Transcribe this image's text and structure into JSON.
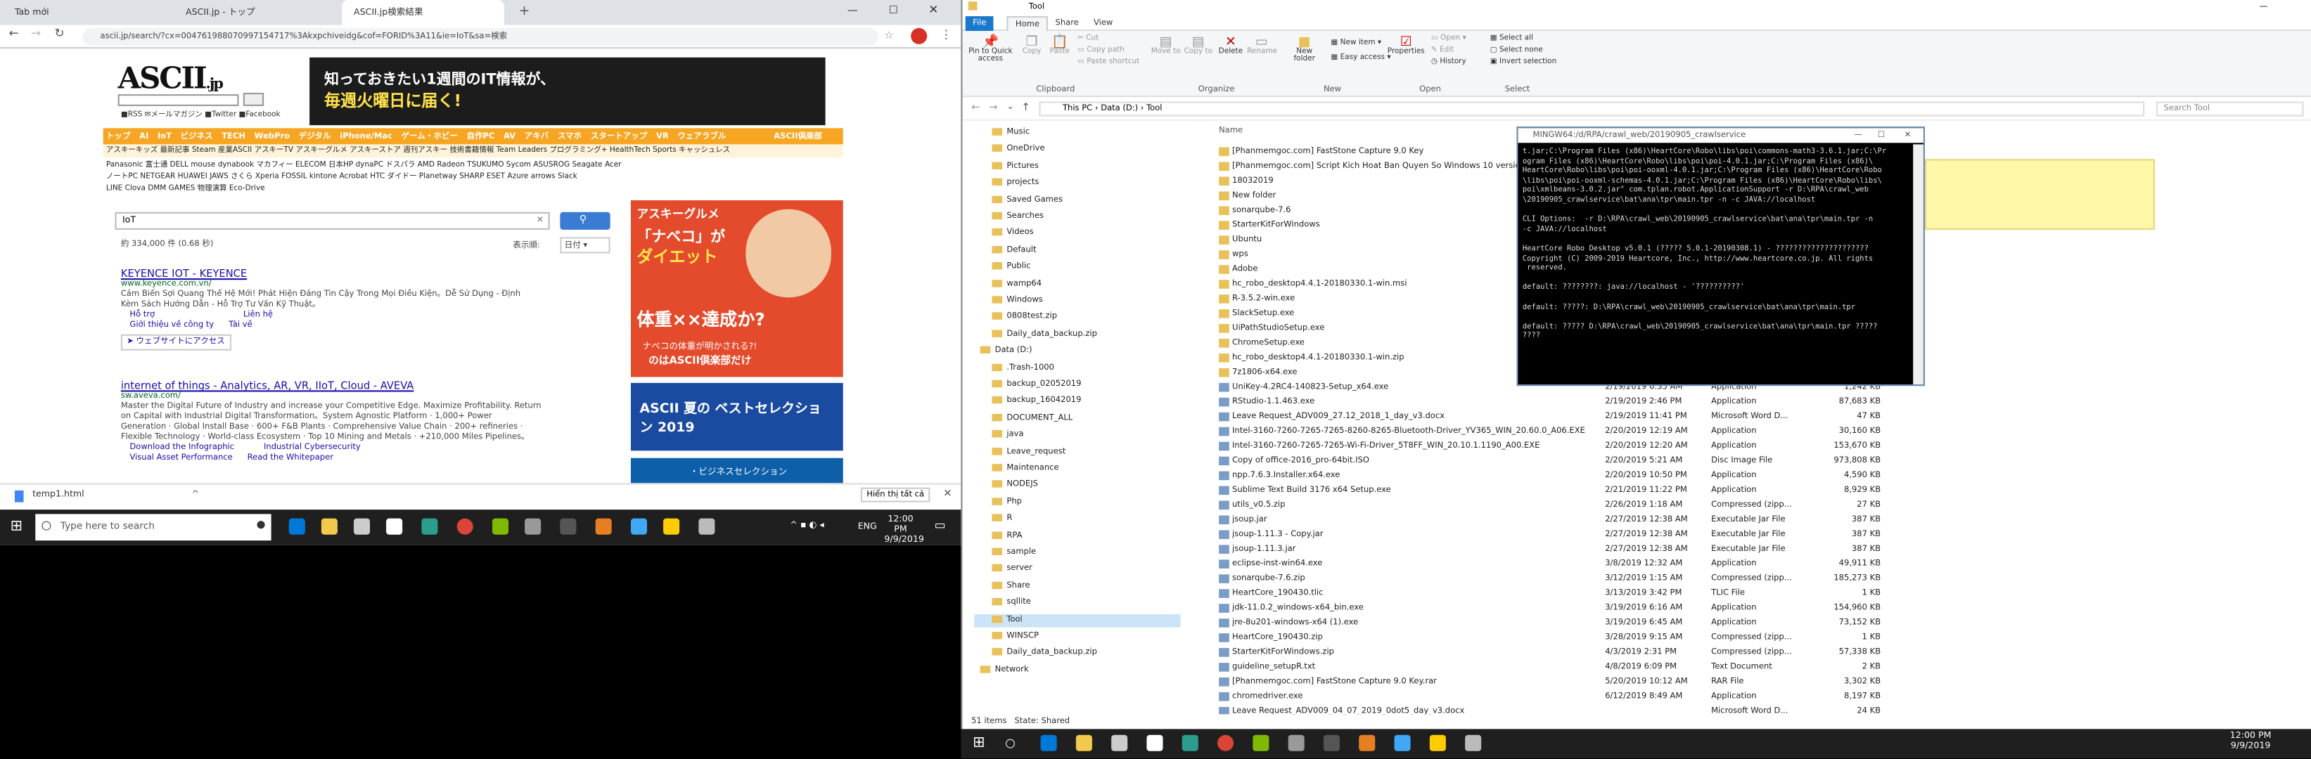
{
  "browser": {
    "tabs": [
      "Tab mới",
      "ASCII.jp - トップ",
      "ASCII.jp検索結果"
    ],
    "url": "ascii.jp/search/?cx=004761988070997154717%3Akxpchiveidg&cof=FORID%3A11&ie=IoT&sa=検索",
    "page": {
      "logo": "ASCII",
      "logo_suffix": ".jp",
      "banner_line1": "知っておきたい1週間のIT情報が、",
      "banner_line2": "毎週火曜日に届く!",
      "nav_items": [
        "トップ",
        "AI",
        "IoT",
        "ビジネス",
        "TECH",
        "WebPro",
        "デジタル",
        "iPhone/Mac",
        "ゲーム・ホビー",
        "自作PC",
        "AV",
        "アキバ",
        "スマホ",
        "スタートアップ",
        "VR",
        "ウェアラブル"
      ],
      "nav_right": "ASCII倶楽部",
      "nav2": "アスキーキッズ 最新記事 Steam 産業ASCII アスキーTV アスキーグルメ アスキーストア 週刊アスキー 技術書籍情報 Team Leaders プログラミング+ HealthTech Sports キャッシュレス",
      "nav3a": "Panasonic 富士通 DELL mouse dynabook マカフィー ELECOM 日本HP dynaPC ドスパラ AMD Radeon TSUKUMO Sycom ASUSROG Seagate Acer",
      "nav3b": "ノートPC NETGEAR HUAWEI JAWS さくら Xperia FOSSIL kintone Acrobat HTC ダイドー Planetway SHARP ESET Azure arrows Slack",
      "nav3c": "LINE Clova DMM GAMES 物理演算 Eco-Drive",
      "query": "IoT",
      "search_button": "",
      "result_count": "約 334,000 件 (0.68 秒)",
      "sort_label": "表示順:",
      "sort_value": "日付",
      "results": [
        {
          "title": "KEYENCE IOT - KEYENCE",
          "url": "www.keyence.com.vn/",
          "snippet1": "Cảm Biến Sợi Quang Thế Hệ Mới! Phát Hiện Đáng Tin Cậy Trong Mọi Điều Kiện。Dễ Sử Dụng - Định",
          "snippet2": "Kèm Sách Hướng Dẫn - Hỗ Trợ Tư Vấn Kỹ Thuật。",
          "links": [
            "Hỗ trợ",
            "Liên hệ",
            "Giới thiệu về công ty",
            "Tài về"
          ],
          "cta": "ウェブサイトにアクセス"
        },
        {
          "title": "internet of things - Analytics, AR, VR, IIoT, Cloud - AVEVA",
          "url": "sw.aveva.com/",
          "snippet1": "Master the Digital Future of Industry and increase your Competitive Edge. Maximize Profitability. Return",
          "snippet2": "on Capital with Industrial Digital Transformation。System Agnostic Platform · 1,000+ Power",
          "snippet3": "Generation · Global Install Base · 600+ F&B Plants · Comprehensive Value Chain · 200+ refineries ·",
          "snippet4": "Flexible Technology · World-class Ecosystem · Top 10 Mining and Metals · +210,000 Miles Pipelines。",
          "links": [
            "Download the Infographic",
            "Industrial Cybersecurity",
            "Visual Asset Performance",
            "Read the Whitepaper"
          ]
        }
      ],
      "ad_text1": "アスキーグルメ",
      "ad_text2": "「ナベコ」が",
      "ad_text3": "ダイエット",
      "ad_text4": "体重××達成か?",
      "ad_text5": "ナベコの体重が明かされる?!",
      "ad_text6": "のはASCII倶楽部だけ",
      "ad2_text": "ASCII 夏の ベストセレクション 2019",
      "ad3_text": "・ビジネスセレクション"
    },
    "download": {
      "file": "temp1.html",
      "show_all": "Hiển thị tất cả"
    }
  },
  "taskbar_left": {
    "search": "Type here to search",
    "time": "12:00 PM",
    "date": "9/9/2019",
    "lang": "ENG"
  },
  "explorer": {
    "title": "Tool",
    "tabs": [
      "File",
      "Home",
      "Share",
      "View"
    ],
    "ribbon": {
      "pin": "Pin to Quick access",
      "copy": "Copy",
      "paste": "Paste",
      "cut": "Cut",
      "copy_path": "Copy path",
      "paste_shortcut": "Paste shortcut",
      "move_to": "Move to",
      "copy_to": "Copy to",
      "delete": "Delete",
      "rename": "Rename",
      "new_folder": "New folder",
      "new_item": "New item",
      "easy_access": "Easy access",
      "properties": "Properties",
      "open": "Open",
      "edit": "Edit",
      "history": "History",
      "select_all": "Select all",
      "select_none": "Select none",
      "invert": "Invert selection",
      "groups": [
        "Clipboard",
        "Organize",
        "New",
        "Open",
        "Select"
      ]
    },
    "path": [
      "This PC",
      "Data (D:)",
      "Tool"
    ],
    "search_placeholder": "Search Tool",
    "column_name": "Name",
    "tree": [
      "Music",
      "OneDrive",
      "Pictures",
      "projects",
      "Saved Games",
      "Searches",
      "Videos",
      "Default",
      "Public",
      "wamp64",
      "Windows",
      "0808test.zip",
      "Daily_data_backup.zip",
      "Data (D:)",
      ".Trash-1000",
      "backup_02052019",
      "backup_16042019",
      "DOCUMENT_ALL",
      "java",
      "Leave_request",
      "Maintenance",
      "NODEJS",
      "Php",
      "R",
      "RPA",
      "sample",
      "server",
      "Share",
      "sqllite",
      "Tool",
      "WINSCP",
      "Daily_data_backup.zip",
      "Network"
    ],
    "files": [
      {
        "name": "[Phanmemgoc.com] FastStone Capture 9.0 Key",
        "date": "",
        "type": "",
        "size": ""
      },
      {
        "name": "[Phanmemgoc.com] Script Kich Hoat Ban Quyen So Windows 10 version 1...",
        "date": "",
        "type": "",
        "size": ""
      },
      {
        "name": "18032019",
        "date": "",
        "type": "",
        "size": ""
      },
      {
        "name": "New folder",
        "date": "",
        "type": "",
        "size": ""
      },
      {
        "name": "sonarqube-7.6",
        "date": "",
        "type": "",
        "size": ""
      },
      {
        "name": "StarterKitForWindows",
        "date": "",
        "type": "",
        "size": ""
      },
      {
        "name": "Ubuntu",
        "date": "",
        "type": "",
        "size": ""
      },
      {
        "name": "wps",
        "date": "",
        "type": "",
        "size": ""
      },
      {
        "name": "Adobe",
        "date": "",
        "type": "",
        "size": ""
      },
      {
        "name": "hc_robo_desktop4.4.1-20180330.1-win.msi",
        "date": "",
        "type": "",
        "size": ""
      },
      {
        "name": "R-3.5.2-win.exe",
        "date": "",
        "type": "",
        "size": ""
      },
      {
        "name": "SlackSetup.exe",
        "date": "",
        "type": "",
        "size": ""
      },
      {
        "name": "UiPathStudioSetup.exe",
        "date": "",
        "type": "",
        "size": ""
      },
      {
        "name": "ChromeSetup.exe",
        "date": "",
        "type": "",
        "size": ""
      },
      {
        "name": "hc_robo_desktop4.4.1-20180330.1-win.zip",
        "date": "",
        "type": "",
        "size": ""
      },
      {
        "name": "7z1806-x64.exe",
        "date": "",
        "type": "",
        "size": ""
      },
      {
        "name": "UniKey-4.2RC4-140823-Setup_x64.exe",
        "date": "2/19/2019 6:35 AM",
        "type": "Application",
        "size": "1,242 KB"
      },
      {
        "name": "RStudio-1.1.463.exe",
        "date": "2/19/2019 2:46 PM",
        "type": "Application",
        "size": "87,683 KB"
      },
      {
        "name": "Leave Request_ADV009_27.12_2018_1_day_v3.docx",
        "date": "2/19/2019 11:41 PM",
        "type": "Microsoft Word D...",
        "size": "47 KB"
      },
      {
        "name": "Intel-3160-7260-7265-7265-8260-8265-Bluetooth-Driver_YV365_WIN_20.60.0_A06.EXE",
        "date": "2/20/2019 12:19 AM",
        "type": "Application",
        "size": "30,160 KB"
      },
      {
        "name": "Intel-3160-7260-7265-7265-Wi-Fi-Driver_5T8FF_WIN_20.10.1.1190_A00.EXE",
        "date": "2/20/2019 12:20 AM",
        "type": "Application",
        "size": "153,670 KB"
      },
      {
        "name": "Copy of office-2016_pro-64bit.ISO",
        "date": "2/20/2019 5:21 AM",
        "type": "Disc Image File",
        "size": "973,808 KB"
      },
      {
        "name": "npp.7.6.3.Installer.x64.exe",
        "date": "2/20/2019 10:50 PM",
        "type": "Application",
        "size": "4,590 KB"
      },
      {
        "name": "Sublime Text Build 3176 x64 Setup.exe",
        "date": "2/21/2019 11:22 PM",
        "type": "Application",
        "size": "8,929 KB"
      },
      {
        "name": "utils_v0.5.zip",
        "date": "2/26/2019 1:18 AM",
        "type": "Compressed (zipp...",
        "size": "27 KB"
      },
      {
        "name": "jsoup.jar",
        "date": "2/27/2019 12:38 AM",
        "type": "Executable Jar File",
        "size": "387 KB"
      },
      {
        "name": "jsoup-1.11.3 - Copy.jar",
        "date": "2/27/2019 12:38 AM",
        "type": "Executable Jar File",
        "size": "387 KB"
      },
      {
        "name": "jsoup-1.11.3.jar",
        "date": "2/27/2019 12:38 AM",
        "type": "Executable Jar File",
        "size": "387 KB"
      },
      {
        "name": "eclipse-inst-win64.exe",
        "date": "3/8/2019 12:32 AM",
        "type": "Application",
        "size": "49,911 KB"
      },
      {
        "name": "sonarqube-7.6.zip",
        "date": "3/12/2019 1:15 AM",
        "type": "Compressed (zipp...",
        "size": "185,273 KB"
      },
      {
        "name": "HeartCore_190430.tlic",
        "date": "3/13/2019 3:42 PM",
        "type": "TLIC File",
        "size": "1 KB"
      },
      {
        "name": "jdk-11.0.2_windows-x64_bin.exe",
        "date": "3/19/2019 6:16 AM",
        "type": "Application",
        "size": "154,960 KB"
      },
      {
        "name": "jre-8u201-windows-x64 (1).exe",
        "date": "3/19/2019 6:45 AM",
        "type": "Application",
        "size": "73,152 KB"
      },
      {
        "name": "HeartCore_190430.zip",
        "date": "3/28/2019 9:15 AM",
        "type": "Compressed (zipp...",
        "size": "1 KB"
      },
      {
        "name": "StarterKitForWindows.zip",
        "date": "4/3/2019 2:31 PM",
        "type": "Compressed (zipp...",
        "size": "57,338 KB"
      },
      {
        "name": "guideline_setupR.txt",
        "date": "4/8/2019 6:09 PM",
        "type": "Text Document",
        "size": "2 KB"
      },
      {
        "name": "[Phanmemgoc.com] FastStone Capture 9.0 Key.rar",
        "date": "5/20/2019 10:12 AM",
        "type": "RAR File",
        "size": "3,302 KB"
      },
      {
        "name": "chromedriver.exe",
        "date": "6/12/2019 8:49 AM",
        "type": "Application",
        "size": "8,197 KB"
      },
      {
        "name": "Leave Request_ADV009_04_07_2019_0dot5_day_v3.docx",
        "date": "",
        "type": "Microsoft Word D...",
        "size": "24 KB"
      }
    ],
    "status_items": "51 items",
    "status_state": "State:",
    "status_shared": "Shared"
  },
  "console": {
    "title": "MINGW64:/d/RPA/crawl_web/20190905_crawlservice",
    "lines": [
      "t.jar;C:\\Program Files (x86)\\HeartCore\\Robo\\libs\\poi\\commons-math3-3.6.1.jar;C:\\Pr",
      "ogram Files (x86)\\HeartCore\\Robo\\libs\\poi\\poi-4.0.1.jar;C:\\Program Files (x86)\\",
      "HeartCore\\Robo\\libs\\poi\\poi-ooxml-4.0.1.jar;C:\\Program Files (x86)\\HeartCore\\Robo",
      "\\libs\\poi\\poi-ooxml-schemas-4.0.1.jar;C:\\Program Files (x86)\\HeartCore\\Robo\\libs\\",
      "poi\\xmlbeans-3.0.2.jar\" com.tplan.robot.ApplicationSupport -r D:\\RPA\\crawl_web",
      "\\20190905_crawlservice\\bat\\ana\\tpr\\main.tpr -n -c JAVA://localhost",
      "",
      "CLI Options:  -r D:\\RPA\\crawl_web\\20190905_crawlservice\\bat\\ana\\tpr\\main.tpr -n",
      "-c JAVA://localhost",
      "",
      "HeartCore Robo Desktop v5.0.1 (????? 5.0.1-20190308.1) - ?????????????????????",
      "Copyright (C) 2009-2019 Heartcore, Inc., http://www.heartcore.co.jp. All rights",
      " reserved.",
      "",
      "default: ????????: java://localhost - '??????????'",
      "",
      "default: ?????: D:\\RPA\\crawl_web\\20190905_crawlservice\\bat\\ana\\tpr\\main.tpr",
      "",
      "default: ????? D:\\RPA\\crawl_web\\20190905_crawlservice\\bat\\ana\\tpr\\main.tpr ?????",
      "????"
    ]
  },
  "taskbar_right": {
    "time": "12:00 PM",
    "date": "9/9/2019"
  },
  "colors": {
    "ascii_orange": "#f6a623",
    "link_blue": "#1a0dab",
    "green_url": "#006621",
    "taskbar": "#1f1f1f"
  }
}
